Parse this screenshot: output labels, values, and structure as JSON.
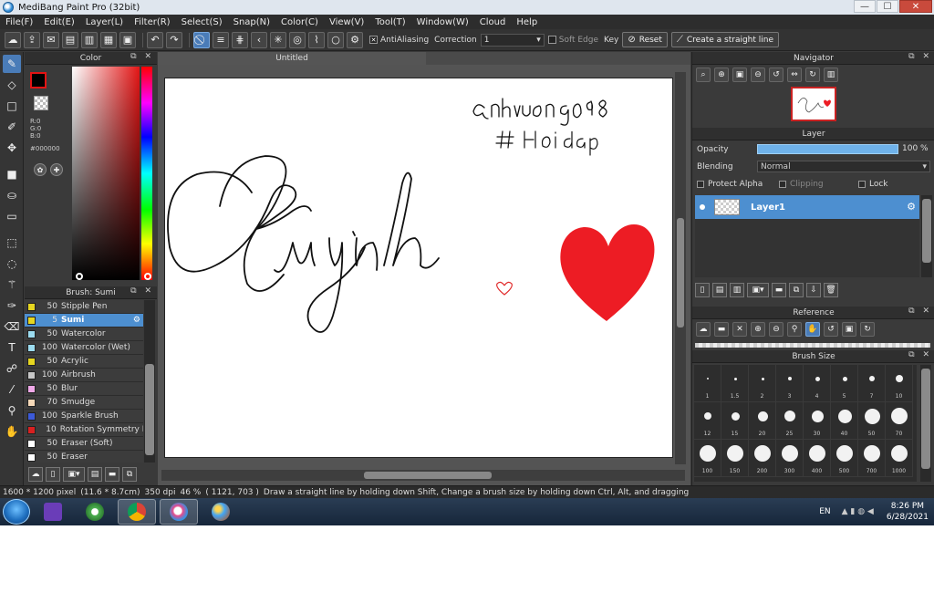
{
  "window": {
    "title": "MediBang Paint Pro (32bit)",
    "minimize": "—",
    "maximize": "☐",
    "close": "✕"
  },
  "menu": [
    "File(F)",
    "Edit(E)",
    "Layer(L)",
    "Filter(R)",
    "Select(S)",
    "Snap(N)",
    "Color(C)",
    "View(V)",
    "Tool(T)",
    "Window(W)",
    "Cloud",
    "Help"
  ],
  "toolbar": {
    "antialiasing_label": "AntiAliasing",
    "antialiasing_checked": true,
    "correction_label": "Correction",
    "correction_value": "1",
    "soft_edge_label": "Soft Edge",
    "key_label": "Key",
    "reset_label": "Reset",
    "straight_line_label": "Create a straight line"
  },
  "color_panel": {
    "title": "Color",
    "foreground": "#000000",
    "accent": "#e41616",
    "r": "R:0",
    "g": "G:0",
    "b": "B:0",
    "hex": "#000000"
  },
  "brush_panel": {
    "title": "Brush: Sumi",
    "brushes": [
      {
        "size": "50",
        "name": "Stipple Pen",
        "color": "#e6d620"
      },
      {
        "size": "5",
        "name": "Sumi",
        "color": "#e6d620",
        "selected": true
      },
      {
        "size": "50",
        "name": "Watercolor",
        "color": "#9cdcf0"
      },
      {
        "size": "100",
        "name": "Watercolor (Wet)",
        "color": "#9cdcf0"
      },
      {
        "size": "50",
        "name": "Acrylic",
        "color": "#e6d620"
      },
      {
        "size": "100",
        "name": "Airbrush",
        "color": "#c8c8c8"
      },
      {
        "size": "50",
        "name": "Blur",
        "color": "#f0a8e8"
      },
      {
        "size": "70",
        "name": "Smudge",
        "color": "#f5d8b8"
      },
      {
        "size": "100",
        "name": "Sparkle Brush",
        "color": "#3c5ad8"
      },
      {
        "size": "10",
        "name": "Rotation Symmetry P",
        "color": "#d82020"
      },
      {
        "size": "50",
        "name": "Eraser (Soft)",
        "color": "#ffffff"
      },
      {
        "size": "50",
        "name": "Eraser",
        "color": "#ffffff"
      }
    ]
  },
  "document": {
    "tab": "Untitled"
  },
  "navigator": {
    "title": "Navigator"
  },
  "layer_panel": {
    "title": "Layer",
    "opacity_label": "Opacity",
    "opacity_value": "100 %",
    "opacity": 1.0,
    "blending_label": "Blending",
    "blending_value": "Normal",
    "protect_alpha": "Protect Alpha",
    "clipping": "Clipping",
    "lock": "Lock",
    "layers": [
      {
        "name": "Layer1"
      }
    ]
  },
  "reference": {
    "title": "Reference"
  },
  "brush_size": {
    "title": "Brush Size",
    "sizes": [
      "1",
      "1.5",
      "2",
      "3",
      "4",
      "5",
      "7",
      "10",
      "12",
      "15",
      "20",
      "25",
      "30",
      "40",
      "50",
      "70",
      "100",
      "150",
      "200",
      "300",
      "400",
      "500",
      "700",
      "1000"
    ]
  },
  "status": {
    "pixels": "1600 * 1200 pixel",
    "cm": "(11.6 * 8.7cm)",
    "dpi": "350 dpi",
    "zoom": "46 %",
    "coords": "( 1121, 703 )",
    "hint": "Draw a straight line by holding down Shift, Change a brush size by holding down Ctrl, Alt, and dragging"
  },
  "taskbar": {
    "lang": "EN",
    "time": "8:26 PM",
    "date": "6/28/2021"
  }
}
